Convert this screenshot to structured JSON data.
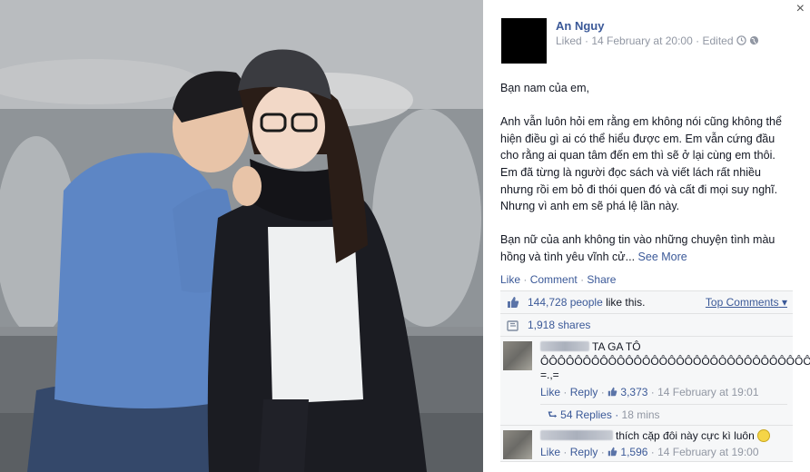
{
  "photo": {
    "alt": "Couple photo"
  },
  "window": {
    "close_label": "×"
  },
  "post": {
    "author": "An Nguy",
    "liked_prefix": "Liked",
    "separator": "·",
    "timestamp": "14 February at 20:00",
    "edited": "Edited",
    "paragraphs": [
      "Bạn nam của em,",
      "Anh vẫn luôn hỏi em rằng em không nói cũng không thể hiện điều gì ai có thể hiểu được em. Em vẫn cứng đầu cho rằng ai quan tâm đến em thì sẽ ở lại cùng em thôi. Em đã từng là người đọc sách và viết lách rất nhiều nhưng rồi em bỏ đi thói quen đó và cất đi mọi suy nghĩ. Nhưng vì anh em sẽ phá lệ lần này."
    ],
    "last_paragraph": "Bạn nữ của anh không tin vào những chuyện tình màu hồng và tình yêu vĩnh cử...",
    "see_more": "See More"
  },
  "actions": {
    "like": "Like",
    "comment": "Comment",
    "share": "Share",
    "dot": "·"
  },
  "feedback": {
    "likes_count": "144,728 people",
    "likes_suffix": " like this.",
    "top_comments": "Top Comments",
    "shares": "1,918 shares"
  },
  "comments": [
    {
      "text": "TA GA TÔ ÔÔÔÔÔÔÔÔÔÔÔÔÔÔÔÔÔÔÔÔÔÔÔÔÔÔÔÔÔÔÔÔ =.,=",
      "like": "Like",
      "reply": "Reply",
      "likes": "3,373",
      "time": "14 February at 19:01",
      "replies": "54 Replies",
      "replies_time": "18 mins"
    },
    {
      "text": "thích cặp đôi này cực kì luôn",
      "like": "Like",
      "reply": "Reply",
      "likes": "1,596",
      "time": "14 February at 19:00"
    }
  ],
  "colors": {
    "link": "#3b5998",
    "muted": "#9197a3",
    "feedback_bg": "#f6f7f8"
  },
  "icons": [
    "close-icon",
    "clock-icon",
    "globe-icon",
    "like-thumb-icon",
    "share-icon",
    "dropdown-caret-icon",
    "replies-icon",
    "smiley-icon"
  ]
}
